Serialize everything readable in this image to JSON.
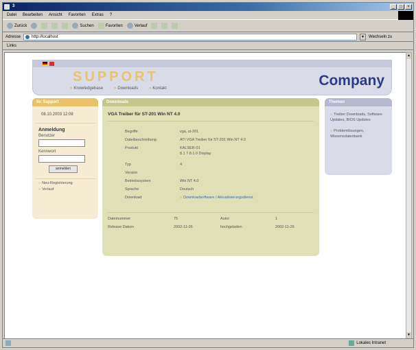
{
  "window": {
    "title": "3"
  },
  "menu": [
    "Datei",
    "Bearbeiten",
    "Ansicht",
    "Favoriten",
    "Extras",
    "?"
  ],
  "toolbar": {
    "back": "Zurück",
    "search": "Suchen",
    "favorites": "Favoriten",
    "history": "Verlauf"
  },
  "address": {
    "label": "Adresse",
    "url": "http://localhost",
    "go": "Wechseln zu"
  },
  "links": {
    "label": "Links"
  },
  "status": {
    "zone": "Lokales Intranet"
  },
  "page": {
    "brand": "SUPPORT",
    "company": "Company",
    "nav": [
      "Knowledgebase",
      "Downloads",
      "Kontakt"
    ],
    "left": {
      "title": "Ihr Support",
      "date": "08.10.2003 12:08",
      "login_title": "Anmeldung",
      "user_label": "Benutzer",
      "pass_label": "Kennwort",
      "login_button": "anmelden",
      "links": [
        "Neu-Registrierung",
        "Verlauf"
      ]
    },
    "center": {
      "title": "Downloads",
      "download_title": "VGA Treiber für ST-201 Win NT 4.0",
      "fields": [
        {
          "k": "Begriffe",
          "v": "vga, st-201"
        },
        {
          "k": "Dateibeschreibung",
          "v": "ATI VGA Treiber für ST-201 Win NT 4.0"
        },
        {
          "k": "Produkt",
          "v": "KALSER-01"
        },
        {
          "k": "",
          "v": "8.1 7.8.1.0 Display"
        },
        {
          "k": "Typ",
          "v": "4"
        },
        {
          "k": "Version",
          "v": ""
        },
        {
          "k": "Betriebssystem",
          "v": "Win NT 4.0"
        },
        {
          "k": "Sprache",
          "v": "Deutsch"
        },
        {
          "k": "Download",
          "v": "Downloadsoftware / Aktualisierungsdienst"
        }
      ],
      "stats": [
        [
          "Dateinummer",
          "75",
          "Autor",
          "1"
        ],
        [
          "Release Datum",
          "2002-11-26",
          "hochgeladen",
          "2002-11-26"
        ]
      ]
    },
    "right": {
      "title": "Themen",
      "links": [
        "Treiber Downloads, Software Updates, BIOS Updates",
        "Problemlösungen, Wissensdatenbank"
      ]
    }
  }
}
